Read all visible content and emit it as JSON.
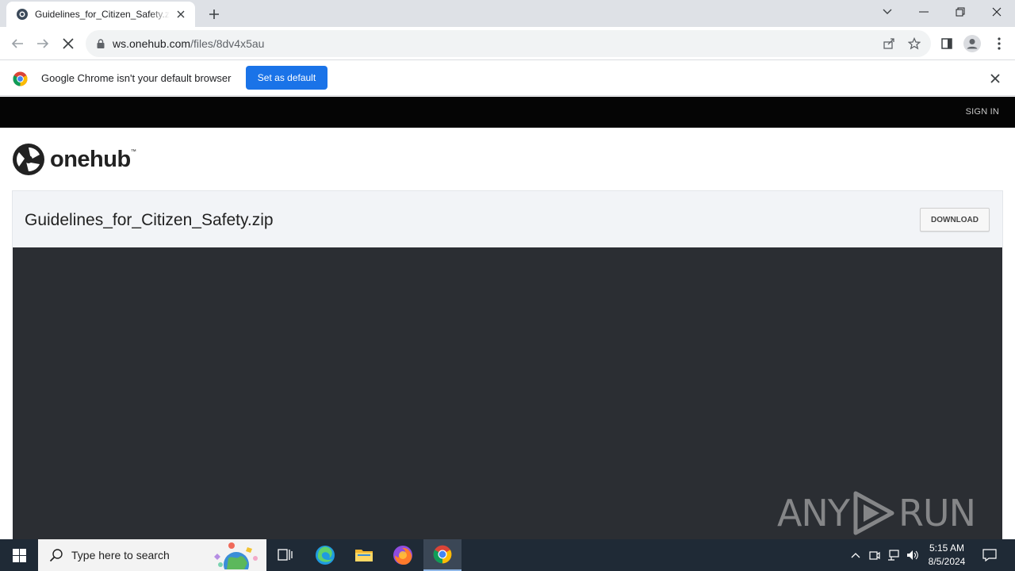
{
  "browser": {
    "tab": {
      "title": "Guidelines_for_Citizen_Safety.zip"
    },
    "address": {
      "domain": "ws.onehub.com",
      "path": "/files/8dv4x5au"
    },
    "infobar": {
      "message": "Google Chrome isn't your default browser",
      "button_label": "Set as default"
    }
  },
  "page": {
    "header": {
      "signin_label": "SIGN IN"
    },
    "logo": {
      "wordmark": "onehub"
    },
    "file": {
      "name": "Guidelines_for_Citizen_Safety.zip",
      "download_label": "DOWNLOAD"
    },
    "watermark": {
      "left": "ANY",
      "right": "RUN"
    }
  },
  "taskbar": {
    "search_placeholder": "Type here to search",
    "time": "5:15 AM",
    "date": "8/5/2024"
  },
  "colors": {
    "accent": "#1a73e8",
    "page_topbar": "#050505",
    "viewer": "#2b2e33",
    "taskbar": "#1f2a36"
  }
}
